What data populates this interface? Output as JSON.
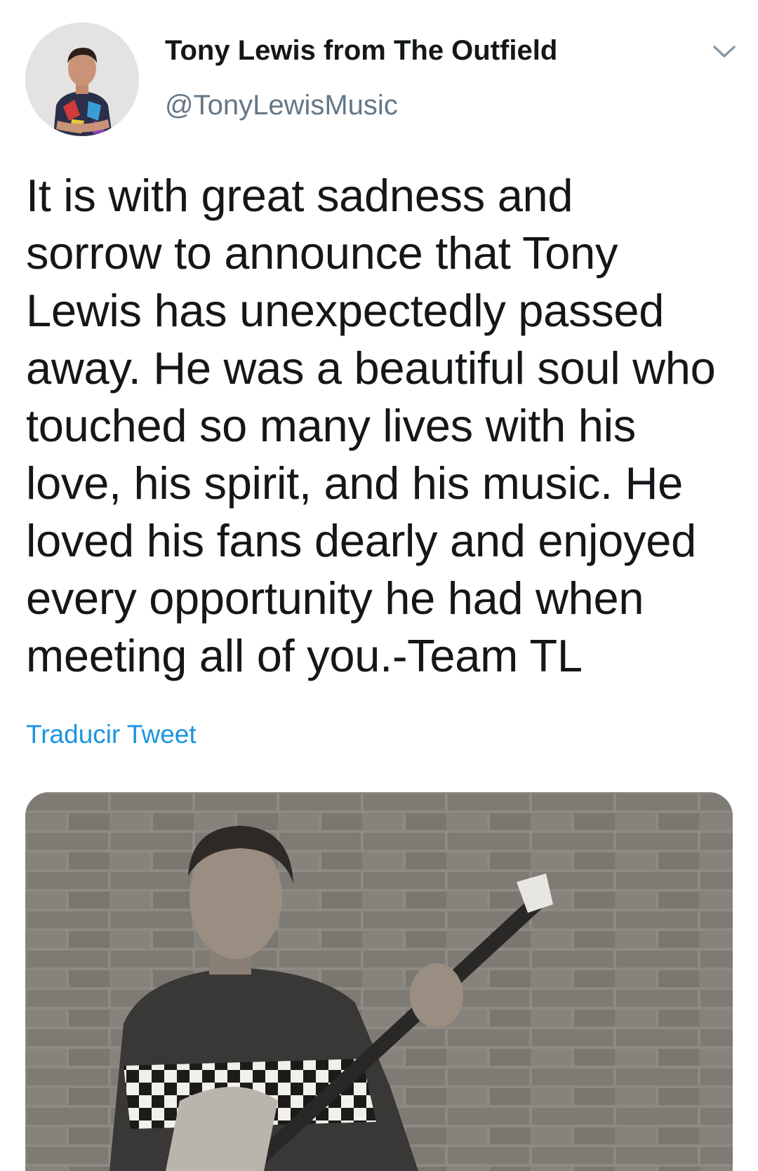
{
  "author": {
    "display_name": "Tony Lewis from The Outfield",
    "handle": "@TonyLewisMusic",
    "avatar_icon": "profile-photo"
  },
  "menu": {
    "icon": "chevron-down-icon"
  },
  "tweet": {
    "lines": [
      "It is with great sadness and",
      "sorrow to announce that Tony",
      "Lewis has unexpectedly passed",
      "away. He was a beautiful soul who",
      "touched so many lives with his",
      "love, his spirit, and his music. He",
      "loved his fans dearly and enjoyed",
      "every opportunity he had when",
      "meeting all of you.-Team TL"
    ],
    "translate_label": "Traducir Tweet"
  },
  "media": {
    "type": "photo"
  },
  "colors": {
    "link": "#1b95e0",
    "secondary_text": "#657786",
    "primary_text": "#14171a"
  }
}
